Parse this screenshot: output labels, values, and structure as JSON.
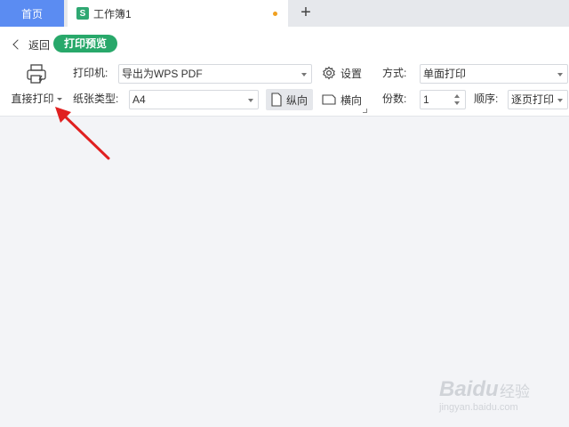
{
  "tabs": {
    "home_label": "首页",
    "doc_icon_letter": "S",
    "doc_title": "工作簿1",
    "new_tab_symbol": "+"
  },
  "toolbar": {
    "back_label": "返回",
    "preview_label": "打印预览",
    "direct_print_label": "直接打印",
    "printer_label": "打印机:",
    "printer_value": "导出为WPS PDF",
    "settings_label": "设置",
    "paper_label": "纸张类型:",
    "paper_value": "A4",
    "portrait_label": "纵向",
    "landscape_label": "横向",
    "mode_label": "方式:",
    "mode_value": "单面打印",
    "copies_label": "份数:",
    "copies_value": "1",
    "order_label": "顺序:",
    "order_value": "逐页打印"
  },
  "watermark": {
    "brand": "Baidu",
    "brand_cn": "经验",
    "url": "jingyan.baidu.com"
  },
  "colors": {
    "accent_blue": "#5b8cf2",
    "preview_green": "#28a86a",
    "arrow_red": "#e02020"
  }
}
